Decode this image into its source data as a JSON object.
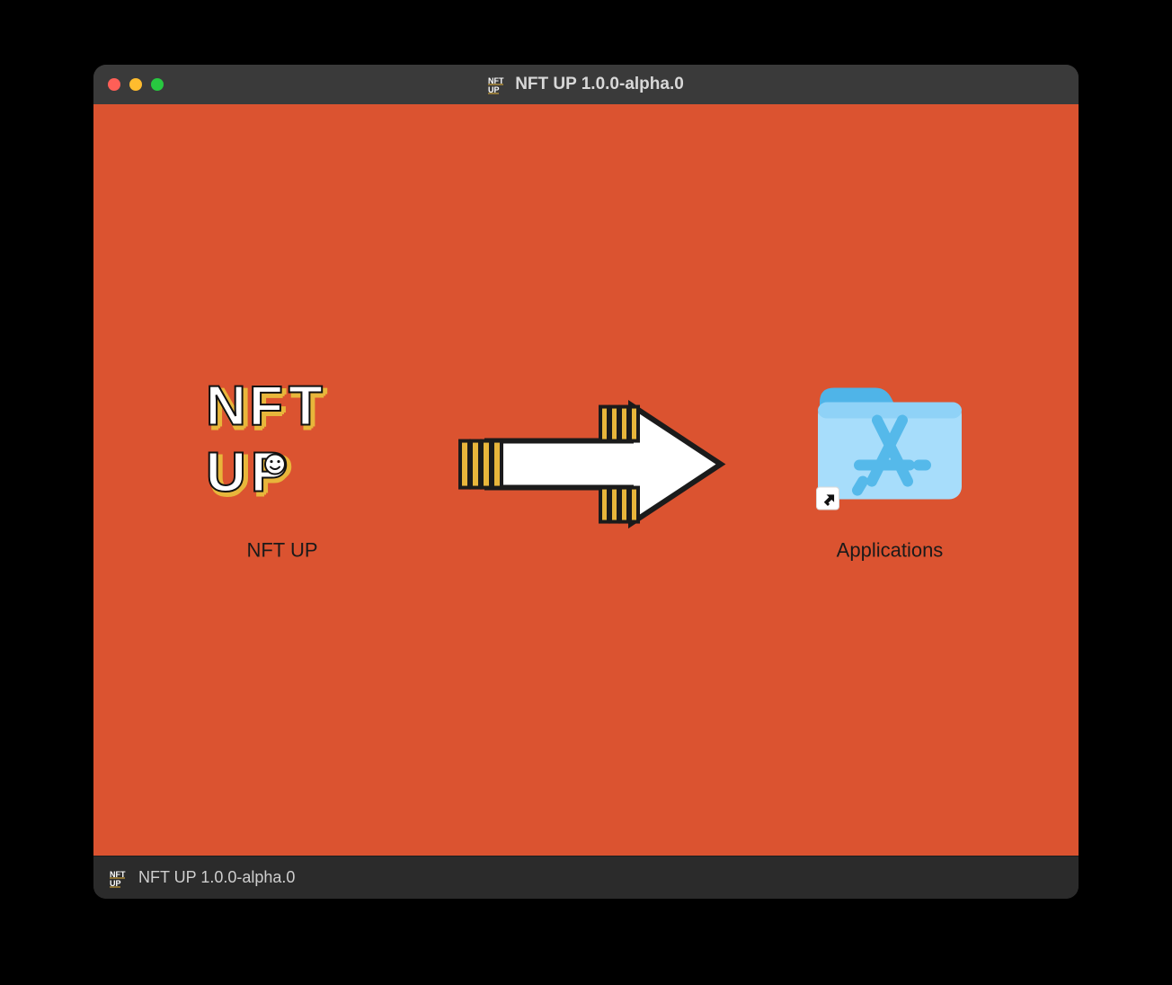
{
  "window": {
    "title": "NFT UP 1.0.0-alpha.0"
  },
  "installer": {
    "app_name": "NFT UP",
    "destination_label": "Applications"
  },
  "statusbar": {
    "text": "NFT UP 1.0.0-alpha.0"
  },
  "colors": {
    "background": "#db5330",
    "accent_yellow": "#e8b63b",
    "folder_light": "#a7ddfb",
    "folder_dark": "#4fb4e8"
  }
}
